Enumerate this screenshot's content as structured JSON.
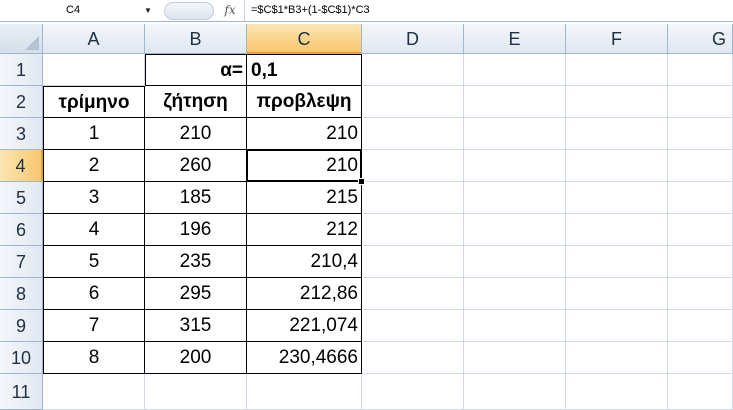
{
  "formula_bar": {
    "name_box": "C4",
    "fx_icon": "fx",
    "formula": "=$C$1*B3+(1-$C$1)*C3"
  },
  "columns": [
    "A",
    "B",
    "C",
    "D",
    "E",
    "F",
    "G"
  ],
  "selected_column": "C",
  "rows": [
    "1",
    "2",
    "3",
    "4",
    "5",
    "6",
    "7",
    "8",
    "9",
    "10",
    "11"
  ],
  "selected_row": "4",
  "cells": {
    "B1": "α=",
    "C1": "0,1",
    "A2": "τρίμηνο",
    "B2": "ζήτηση",
    "C2": "προβλεψη",
    "A3": "1",
    "B3": "210",
    "C3": "210",
    "A4": "2",
    "B4": "260",
    "C4": "210",
    "A5": "3",
    "B5": "185",
    "C5": "215",
    "A6": "4",
    "B6": "196",
    "C6": "212",
    "A7": "5",
    "B7": "235",
    "C7": "210,4",
    "A8": "6",
    "B8": "295",
    "C8": "212,86",
    "A9": "7",
    "B9": "315",
    "C9": "221,074",
    "A10": "8",
    "B10": "200",
    "C10": "230,4666"
  },
  "colors": {
    "header_selected": "#f8c76d",
    "grid_line": "#d0d7e5",
    "header_border": "#9eb6ce"
  }
}
